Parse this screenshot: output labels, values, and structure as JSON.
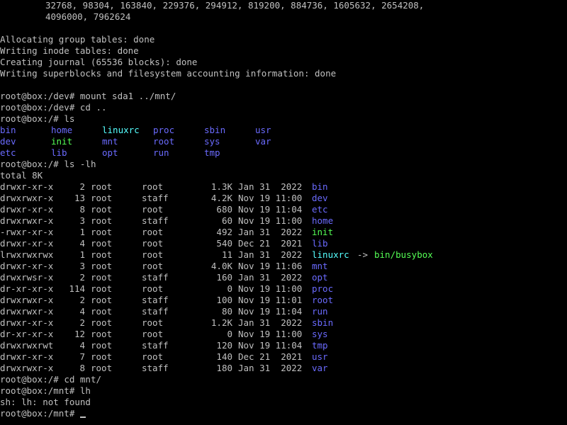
{
  "colors": {
    "background": "#000000",
    "text": "#c0c0c0",
    "directory": "#6b6bff",
    "executable": "#55ff55",
    "symlink": "#55ffff"
  },
  "mkfs_output": {
    "backups_line1": "32768, 98304, 163840, 229376, 294912, 819200, 884736, 1605632, 2654208,",
    "backups_line2": "4096000, 7962624",
    "messages": [
      "Allocating group tables: done",
      "Writing inode tables: done",
      "Creating journal (65536 blocks): done",
      "Writing superblocks and filesystem accounting information: done"
    ]
  },
  "commands": [
    {
      "prompt": "root@box:/dev# ",
      "cmd": "mount sda1 ../mnt/"
    },
    {
      "prompt": "root@box:/dev# ",
      "cmd": "cd .."
    },
    {
      "prompt": "root@box:/# ",
      "cmd": "ls"
    },
    {
      "prompt": "root@box:/# ",
      "cmd": "ls -lh"
    },
    {
      "prompt": "root@box:/# ",
      "cmd": "cd mnt/"
    },
    {
      "prompt": "root@box:/mnt# ",
      "cmd": "lh"
    },
    {
      "prompt": "root@box:/mnt# ",
      "cmd": ""
    }
  ],
  "ls_output": {
    "rows": [
      [
        {
          "name": "bin",
          "type": "dir"
        },
        {
          "name": "home",
          "type": "dir"
        },
        {
          "name": "linuxrc",
          "type": "lnk"
        },
        {
          "name": "proc",
          "type": "dir"
        },
        {
          "name": "sbin",
          "type": "dir"
        },
        {
          "name": "usr",
          "type": "dir"
        }
      ],
      [
        {
          "name": "dev",
          "type": "dir"
        },
        {
          "name": "init",
          "type": "exe"
        },
        {
          "name": "mnt",
          "type": "dir"
        },
        {
          "name": "root",
          "type": "dir"
        },
        {
          "name": "sys",
          "type": "dir"
        },
        {
          "name": "var",
          "type": "dir"
        }
      ],
      [
        {
          "name": "etc",
          "type": "dir"
        },
        {
          "name": "lib",
          "type": "dir"
        },
        {
          "name": "opt",
          "type": "dir"
        },
        {
          "name": "run",
          "type": "dir"
        },
        {
          "name": "tmp",
          "type": "dir"
        }
      ]
    ]
  },
  "ls_lh_output": {
    "total": "total 8K",
    "entries": [
      {
        "perms": "drwxr-xr-x",
        "links": "2",
        "owner": "root",
        "group": "root",
        "size": "1.3K",
        "date": "Jan 31  2022",
        "name": "bin",
        "type": "dir"
      },
      {
        "perms": "drwxrwxr-x",
        "links": "13",
        "owner": "root",
        "group": "staff",
        "size": "4.2K",
        "date": "Nov 19 11:00",
        "name": "dev",
        "type": "dir"
      },
      {
        "perms": "drwxr-xr-x",
        "links": "8",
        "owner": "root",
        "group": "root",
        "size": "680",
        "date": "Nov 19 11:04",
        "name": "etc",
        "type": "dir"
      },
      {
        "perms": "drwxrwxr-x",
        "links": "3",
        "owner": "root",
        "group": "staff",
        "size": "60",
        "date": "Nov 19 11:00",
        "name": "home",
        "type": "dir"
      },
      {
        "perms": "-rwxr-xr-x",
        "links": "1",
        "owner": "root",
        "group": "root",
        "size": "492",
        "date": "Jan 31  2022",
        "name": "init",
        "type": "exe"
      },
      {
        "perms": "drwxr-xr-x",
        "links": "4",
        "owner": "root",
        "group": "root",
        "size": "540",
        "date": "Dec 21  2021",
        "name": "lib",
        "type": "dir"
      },
      {
        "perms": "lrwxrwxrwx",
        "links": "1",
        "owner": "root",
        "group": "root",
        "size": "11",
        "date": "Jan 31  2022",
        "name": "linuxrc",
        "type": "lnk",
        "target": "bin/busybox"
      },
      {
        "perms": "drwxr-xr-x",
        "links": "3",
        "owner": "root",
        "group": "root",
        "size": "4.0K",
        "date": "Nov 19 11:06",
        "name": "mnt",
        "type": "dir"
      },
      {
        "perms": "drwxrwsr-x",
        "links": "2",
        "owner": "root",
        "group": "staff",
        "size": "160",
        "date": "Jan 31  2022",
        "name": "opt",
        "type": "dir"
      },
      {
        "perms": "dr-xr-xr-x",
        "links": "114",
        "owner": "root",
        "group": "root",
        "size": "0",
        "date": "Nov 19 11:00",
        "name": "proc",
        "type": "dir"
      },
      {
        "perms": "drwxrwxr-x",
        "links": "2",
        "owner": "root",
        "group": "staff",
        "size": "100",
        "date": "Nov 19 11:01",
        "name": "root",
        "type": "dir"
      },
      {
        "perms": "drwxrwxr-x",
        "links": "4",
        "owner": "root",
        "group": "staff",
        "size": "80",
        "date": "Nov 19 11:04",
        "name": "run",
        "type": "dir"
      },
      {
        "perms": "drwxr-xr-x",
        "links": "2",
        "owner": "root",
        "group": "root",
        "size": "1.2K",
        "date": "Jan 31  2022",
        "name": "sbin",
        "type": "dir"
      },
      {
        "perms": "dr-xr-xr-x",
        "links": "12",
        "owner": "root",
        "group": "root",
        "size": "0",
        "date": "Nov 19 11:00",
        "name": "sys",
        "type": "dir"
      },
      {
        "perms": "drwxrwxrwt",
        "links": "4",
        "owner": "root",
        "group": "staff",
        "size": "120",
        "date": "Nov 19 11:04",
        "name": "tmp",
        "type": "dir"
      },
      {
        "perms": "drwxr-xr-x",
        "links": "7",
        "owner": "root",
        "group": "root",
        "size": "140",
        "date": "Dec 21  2021",
        "name": "usr",
        "type": "dir"
      },
      {
        "perms": "drwxrwxr-x",
        "links": "8",
        "owner": "root",
        "group": "staff",
        "size": "180",
        "date": "Jan 31  2022",
        "name": "var",
        "type": "dir"
      }
    ]
  },
  "error_line": "sh: lh: not found"
}
